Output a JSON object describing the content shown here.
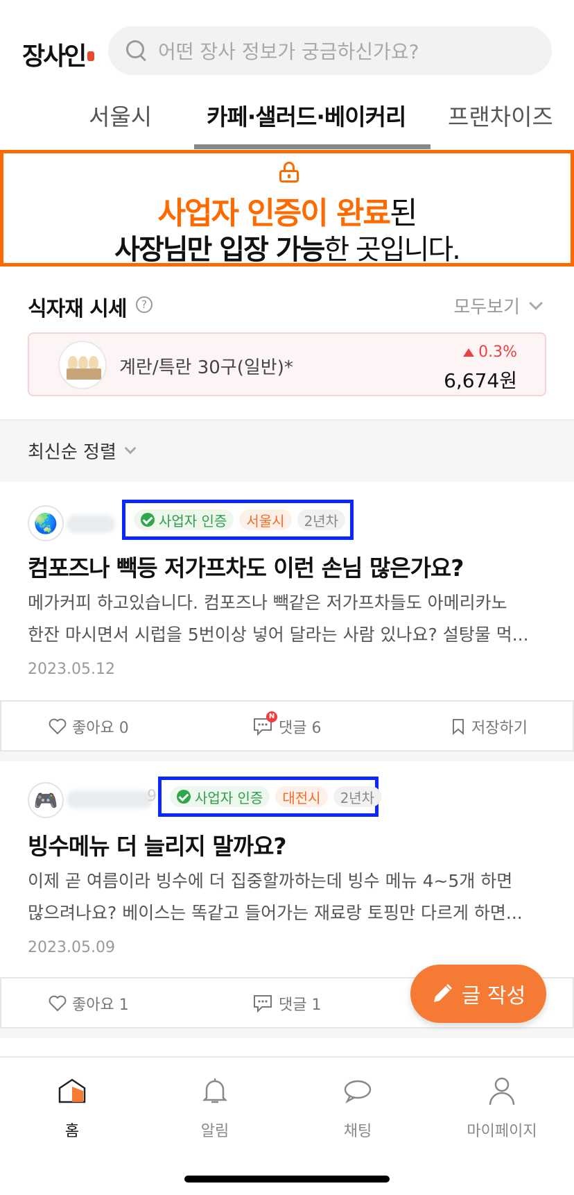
{
  "header": {
    "logo_text": "장사인",
    "search_placeholder": "어떤 장사 정보가 궁금하신가요?"
  },
  "tabs": [
    {
      "label": "서울시",
      "active": false
    },
    {
      "label": "카페·샐러드·베이커리",
      "active": true
    },
    {
      "label": "프랜차이즈",
      "active": false
    }
  ],
  "banner": {
    "line1_highlight": "사업자 인증이 완료",
    "line1_rest": "된",
    "line2_bold": "사장님만 입장 가능",
    "line2_rest": "한 곳입니다.",
    "icon": "unlock-icon"
  },
  "market": {
    "title": "식자재 시세",
    "see_all": "모두보기",
    "item": {
      "name": "계란/특란 30구(일반)*",
      "change": "0.3%",
      "change_direction": "up",
      "price": "6,674원"
    }
  },
  "sort": {
    "label": "최신순 정렬"
  },
  "posts": [
    {
      "avatar_icon": "earth-icon",
      "badges": {
        "verified": "사업자 인증",
        "region": "서울시",
        "years": "2년차"
      },
      "title": "컴포즈나 빽등 저가프차도 이런 손님 많은가요?",
      "body_line1": "메가커피 하고있습니다. 컴포즈나 빽같은 저가프차들도 아메리카노",
      "body_line2": "한잔 마시면서 시럽을 5번이상 넣어 달라는 사람 있나요? 설탕물 먹...",
      "date": "2023.05.12",
      "likes": "좋아요 0",
      "comments": "댓글 6",
      "comment_new_badge": "N",
      "save": "저장하기"
    },
    {
      "avatar_icon": "gamepad-icon",
      "name_partial": "9",
      "badges": {
        "verified": "사업자 인증",
        "region": "대전시",
        "years": "2년차"
      },
      "title": "빙수메뉴 더 늘리지 말까요?",
      "body_line1": "이제 곧 여름이라 빙수에 더 집중할까하는데 빙수 메뉴 4~5개 하면",
      "body_line2": "많으려나요? 베이스는 똑같고 들어가는 재료랑 토핑만 다르게 하면...",
      "date": "2023.05.09",
      "likes": "좋아요 1",
      "comments": "댓글 1"
    }
  ],
  "fab": {
    "label": "글 작성"
  },
  "bottom_nav": [
    {
      "label": "홈",
      "icon": "home-icon",
      "active": true
    },
    {
      "label": "알림",
      "icon": "bell-icon",
      "active": false
    },
    {
      "label": "채팅",
      "icon": "chat-icon",
      "active": false
    },
    {
      "label": "마이페이지",
      "icon": "person-icon",
      "active": false
    }
  ],
  "colors": {
    "accent": "#ff6a00",
    "fab": "#f57a34",
    "highlight_box": "#0a27ff",
    "verified": "#2ea84a",
    "price_up": "#e94242"
  }
}
